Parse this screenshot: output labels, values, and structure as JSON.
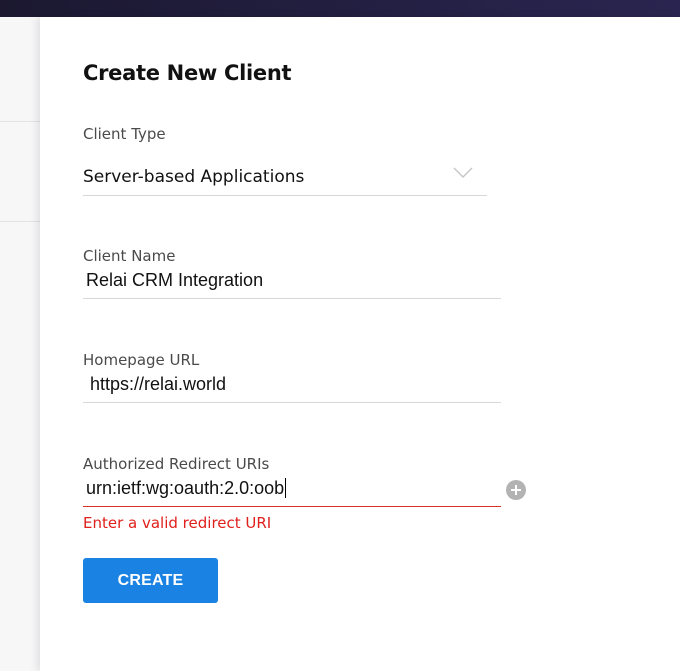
{
  "form": {
    "title": "Create New Client",
    "client_type": {
      "label": "Client Type",
      "selected": "Server-based Applications"
    },
    "client_name": {
      "label": "Client Name",
      "value": "Relai CRM Integration"
    },
    "homepage_url": {
      "label": "Homepage URL",
      "value": "https://relai.world"
    },
    "redirect_uris": {
      "label": "Authorized Redirect URIs",
      "value": "urn:ietf:wg:oauth:2.0:oob",
      "error": "Enter a valid redirect URI"
    },
    "create_label": "CREATE"
  },
  "colors": {
    "accent": "#1a82e2",
    "error": "#e0201c",
    "topbar": "#1b1830"
  },
  "icons": [
    "chevron-down-icon",
    "add-icon"
  ]
}
